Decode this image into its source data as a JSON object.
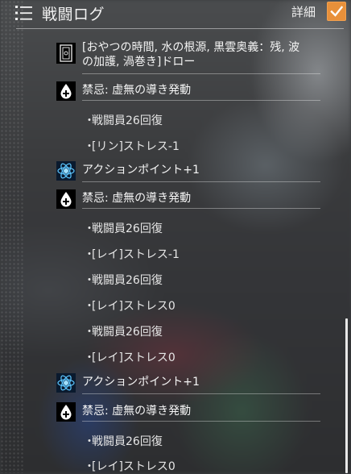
{
  "header": {
    "title": "戦闘ログ",
    "detail_label": "詳細",
    "detail_checked": true,
    "accent": "#e8903a"
  },
  "log": {
    "card_entry": {
      "icon": "card-icon",
      "line1": "[おやつの時間, 水の根源, 黒雲奥義：残, 波",
      "line2": "の加護, 渦巻き]ドロー"
    },
    "seal_entry_1": {
      "icon": "drop-plus-icon",
      "text": "禁忌: 虚無の導き発動"
    },
    "sub_1": {
      "bullet": "・",
      "text": "戦闘員26回復"
    },
    "sub_2": {
      "bullet": "・",
      "text": "[リン]ストレス-1"
    },
    "ap_entry_1": {
      "icon": "atom-icon",
      "text": "アクションポイント+1"
    },
    "seal_entry_2": {
      "icon": "drop-plus-icon",
      "text": "禁忌: 虚無の導き発動"
    },
    "sub_3": {
      "bullet": "・",
      "text": "戦闘員26回復"
    },
    "sub_4": {
      "bullet": "・",
      "text": "[レイ]ストレス-1"
    },
    "sub_5": {
      "bullet": "・",
      "text": "戦闘員26回復"
    },
    "sub_6": {
      "bullet": "・",
      "text": "[レイ]ストレス0"
    },
    "sub_7": {
      "bullet": "・",
      "text": "戦闘員26回復"
    },
    "sub_8": {
      "bullet": "・",
      "text": "[レイ]ストレス0"
    },
    "ap_entry_2": {
      "icon": "atom-icon",
      "text": "アクションポイント+1"
    },
    "seal_entry_3": {
      "icon": "drop-plus-icon",
      "text": "禁忌: 虚無の導き発動"
    },
    "sub_9": {
      "bullet": "・",
      "text": "戦闘員26回復"
    },
    "sub_10": {
      "bullet": "・",
      "text": "[レイ]ストレス0"
    }
  }
}
